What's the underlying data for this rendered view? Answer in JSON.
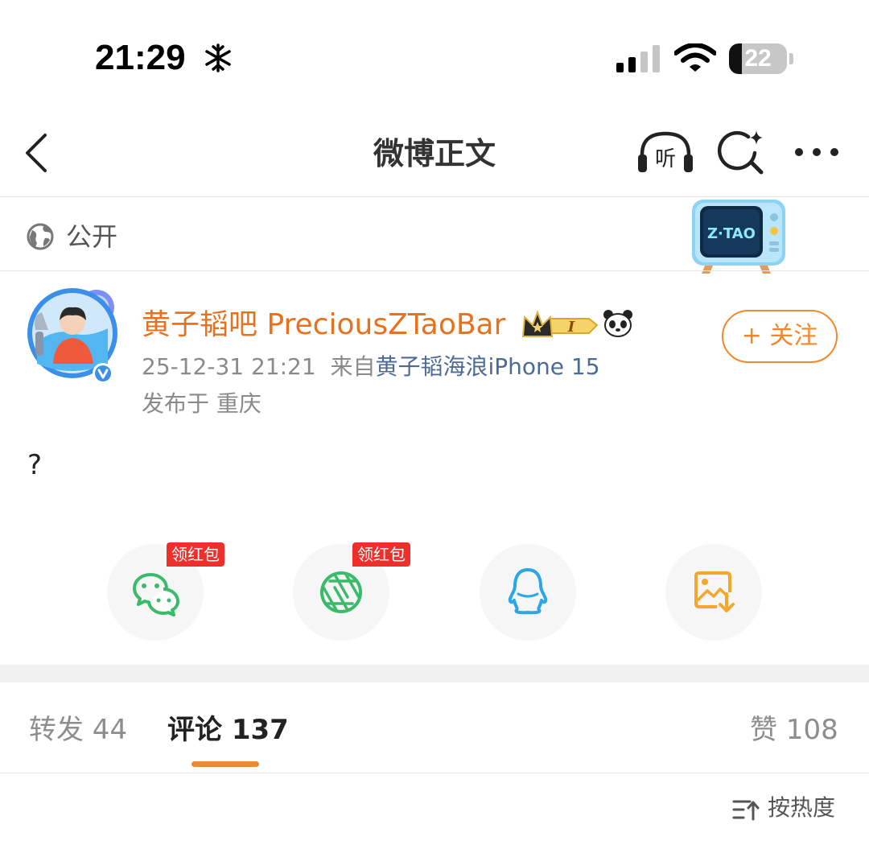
{
  "status_bar": {
    "time": "21:29",
    "battery": "22",
    "battery_level": 0.22
  },
  "nav": {
    "title": "微博正文",
    "back_icon": "chevron-left-icon",
    "listen_label": "听",
    "search_icon": "sparkle-search-icon",
    "more_icon": "more-dots-icon"
  },
  "visibility": {
    "icon": "globe-icon",
    "label": "公开",
    "badge_text": "Z·TAO"
  },
  "post": {
    "author": "黄子韬吧 PreciousZTaoBar",
    "level_badge": "I",
    "time": "25-12-31 21:21",
    "from_prefix": "来自",
    "source": "黄子韬海浪iPhone 15",
    "location": "发布于 重庆",
    "follow_label": "+ 关注",
    "body": "?"
  },
  "share": {
    "items": [
      {
        "name": "wechat",
        "icon": "wechat-icon",
        "tag": "领红包",
        "color": "#3bba6a"
      },
      {
        "name": "moments",
        "icon": "moments-shutter-icon",
        "tag": "领红包",
        "color": "#3bba6a"
      },
      {
        "name": "qq",
        "icon": "qq-penguin-icon",
        "tag": "",
        "color": "#2aa7e6"
      },
      {
        "name": "save-image",
        "icon": "save-image-icon",
        "tag": "",
        "color": "#f3a72c"
      }
    ]
  },
  "tabs": {
    "repost": "转发 44",
    "comment": "评论 137",
    "like": "赞 108"
  },
  "sort": {
    "label": "按热度",
    "icon": "sort-icon"
  },
  "colors": {
    "accent": "#f0882d",
    "author": "#e8711d",
    "link": "#4c6a93",
    "red_tag": "#ee2f2c"
  }
}
